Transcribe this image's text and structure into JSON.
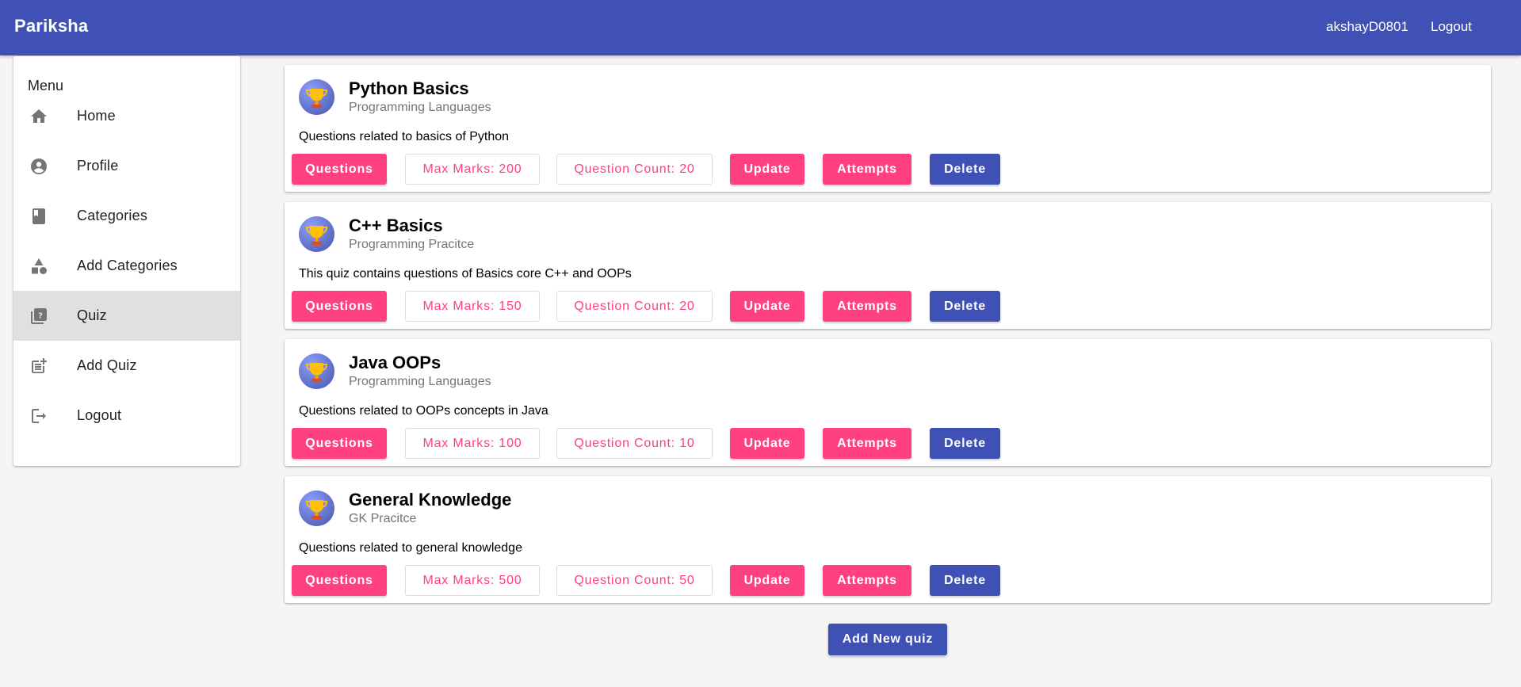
{
  "header": {
    "brand": "Pariksha",
    "username": "akshayD0801",
    "logout_label": "Logout"
  },
  "sidebar": {
    "title": "Menu",
    "items": [
      {
        "label": "Home",
        "icon": "home-icon"
      },
      {
        "label": "Profile",
        "icon": "account-circle-icon"
      },
      {
        "label": "Categories",
        "icon": "book-icon"
      },
      {
        "label": "Add Categories",
        "icon": "category-shapes-icon"
      },
      {
        "label": "Quiz",
        "icon": "quiz-icon",
        "active": true
      },
      {
        "label": "Add Quiz",
        "icon": "post-add-icon"
      },
      {
        "label": "Logout",
        "icon": "logout-icon"
      }
    ]
  },
  "quizzes": [
    {
      "title": "Python Basics",
      "category": "Programming Languages",
      "description": "Questions related to basics of Python",
      "max_marks": "Max Marks: 200",
      "question_count": "Question Count: 20"
    },
    {
      "title": "C++ Basics",
      "category": "Programming Pracitce",
      "description": "This quiz contains questions of Basics core C++ and OOPs",
      "max_marks": "Max Marks: 150",
      "question_count": "Question Count: 20"
    },
    {
      "title": "Java OOPs",
      "category": "Programming Languages",
      "description": "Questions related to OOPs concepts in Java",
      "max_marks": "Max Marks: 100",
      "question_count": "Question Count: 10"
    },
    {
      "title": "General Knowledge",
      "category": "GK Pracitce",
      "description": "Questions related to general knowledge",
      "max_marks": "Max Marks: 500",
      "question_count": "Question Count: 50"
    }
  ],
  "actions": {
    "questions": "Questions",
    "update": "Update",
    "attempts": "Attempts",
    "delete": "Delete"
  },
  "add_quiz_label": "Add New quiz",
  "colors": {
    "primary": "#3f51b5",
    "accent": "#ff4081",
    "active_nav": "#e0e0e0",
    "background": "#f5f5f5"
  }
}
